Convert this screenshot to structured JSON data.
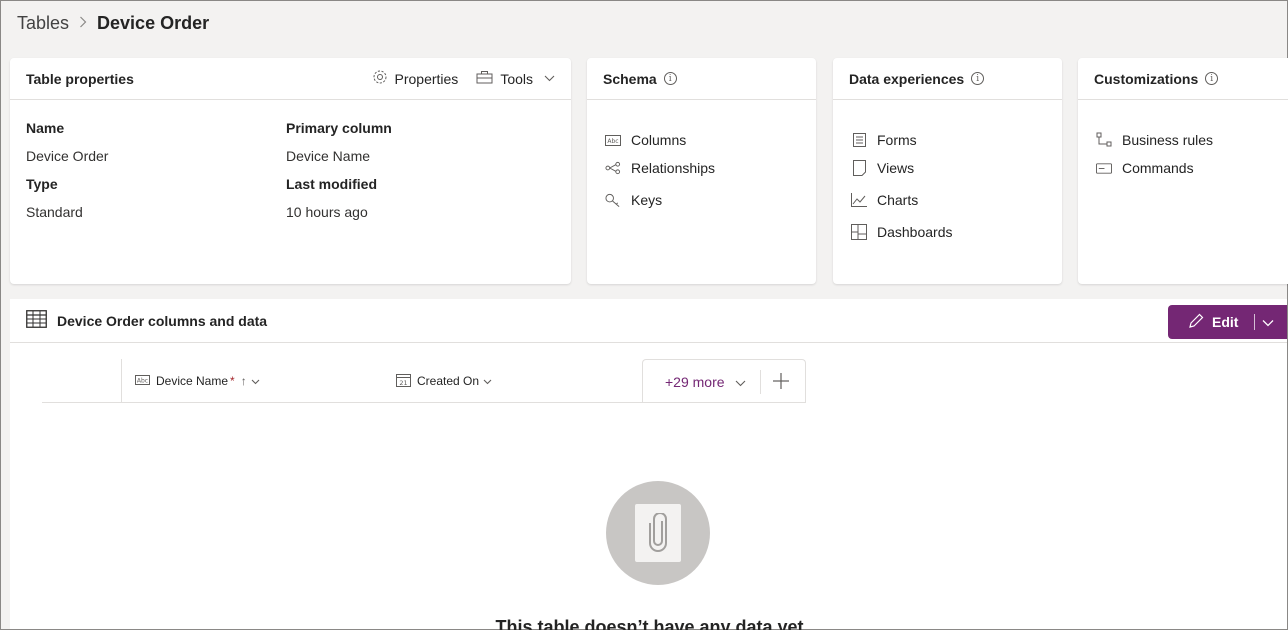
{
  "breadcrumb": {
    "parent": "Tables",
    "separator": ">",
    "current": "Device Order"
  },
  "table_properties": {
    "title": "Table properties",
    "properties_label": "Properties",
    "tools_label": "Tools",
    "fields": [
      {
        "label": "Name",
        "value": "Device Order"
      },
      {
        "label": "Type",
        "value": "Standard"
      },
      {
        "label": "Primary column",
        "value": "Device Name"
      },
      {
        "label": "Last modified",
        "value": "10 hours ago"
      }
    ]
  },
  "schema": {
    "title": "Schema",
    "items": [
      {
        "label": "Columns",
        "icon": "columns-icon"
      },
      {
        "label": "Relationships",
        "icon": "relationships-icon"
      },
      {
        "label": "Keys",
        "icon": "key-icon"
      }
    ]
  },
  "data_experiences": {
    "title": "Data experiences",
    "items": [
      {
        "label": "Forms",
        "icon": "form-icon"
      },
      {
        "label": "Views",
        "icon": "view-icon"
      },
      {
        "label": "Charts",
        "icon": "chart-icon"
      },
      {
        "label": "Dashboards",
        "icon": "dashboard-icon"
      }
    ]
  },
  "customizations": {
    "title": "Customizations",
    "items": [
      {
        "label": "Business rules",
        "icon": "business-rules-icon"
      },
      {
        "label": "Commands",
        "icon": "commands-icon"
      }
    ]
  },
  "data_panel": {
    "title": "Device Order columns and data",
    "edit_label": "Edit",
    "columns": [
      {
        "label": "Device Name",
        "required_mark": "*",
        "sort": "↑",
        "icon": "text-field-icon"
      },
      {
        "label": "Created On",
        "icon": "calendar-icon"
      }
    ],
    "more_label": "+29 more",
    "empty_message": "This table doesn’t have any data yet"
  },
  "colors": {
    "accent": "#742774",
    "background": "#f3f2f1",
    "card": "#ffffff"
  }
}
